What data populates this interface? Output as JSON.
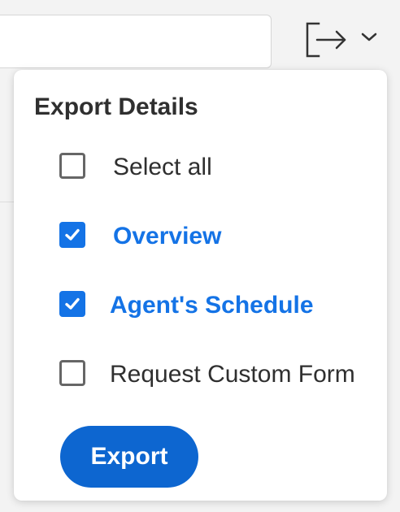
{
  "toolbar": {
    "export_icon": "export-arrow-icon",
    "dropdown_icon": "chevron-down-icon"
  },
  "export_panel": {
    "title": "Export Details",
    "items": [
      {
        "label": "Select all",
        "checked": false
      },
      {
        "label": "Overview",
        "checked": true
      },
      {
        "label": "Agent's Schedule",
        "checked": true
      },
      {
        "label": "Request Custom Form",
        "checked": false
      }
    ],
    "button_label": "Export"
  },
  "colors": {
    "accent": "#1473e6",
    "button": "#0d66d0",
    "text": "#2f2f2f",
    "checkbox_border": "#666666"
  }
}
